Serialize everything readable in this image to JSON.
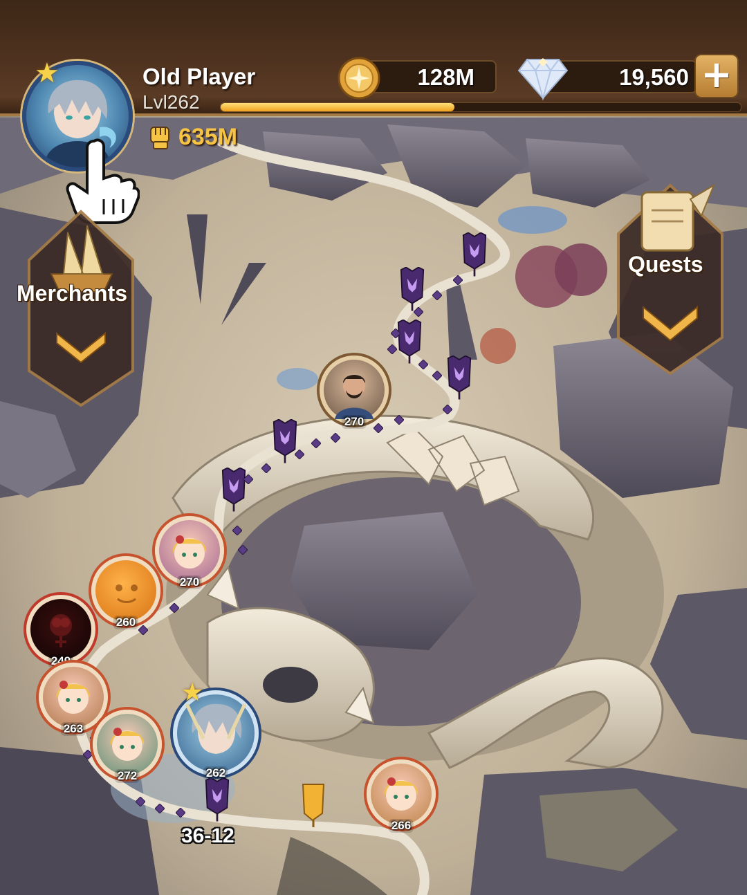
{
  "player": {
    "name": "Old Player",
    "level_text": "Lvl262",
    "xp_progress": 0.45,
    "power": "635M"
  },
  "currency": {
    "gold": "128M",
    "gems": "19,560",
    "add_label": "+"
  },
  "side_buttons": {
    "merchants": "Merchants",
    "quests": "Quests"
  },
  "map_nodes": [
    {
      "level": "270",
      "kind": "photo"
    },
    {
      "level": "270",
      "kind": "girl"
    },
    {
      "level": "260",
      "kind": "orange"
    },
    {
      "level": "249",
      "kind": "dark"
    },
    {
      "level": "263",
      "kind": "girl"
    },
    {
      "level": "272",
      "kind": "girl"
    },
    {
      "level": "262",
      "kind": "hero"
    },
    {
      "level": "266",
      "kind": "girl"
    }
  ],
  "stage": "36-12",
  "colors": {
    "gold_text": "#f6c445",
    "xp_fill": "#f0a21c",
    "frame_brown": "#4f3320",
    "enemy_banner": "#4a2a6e"
  }
}
